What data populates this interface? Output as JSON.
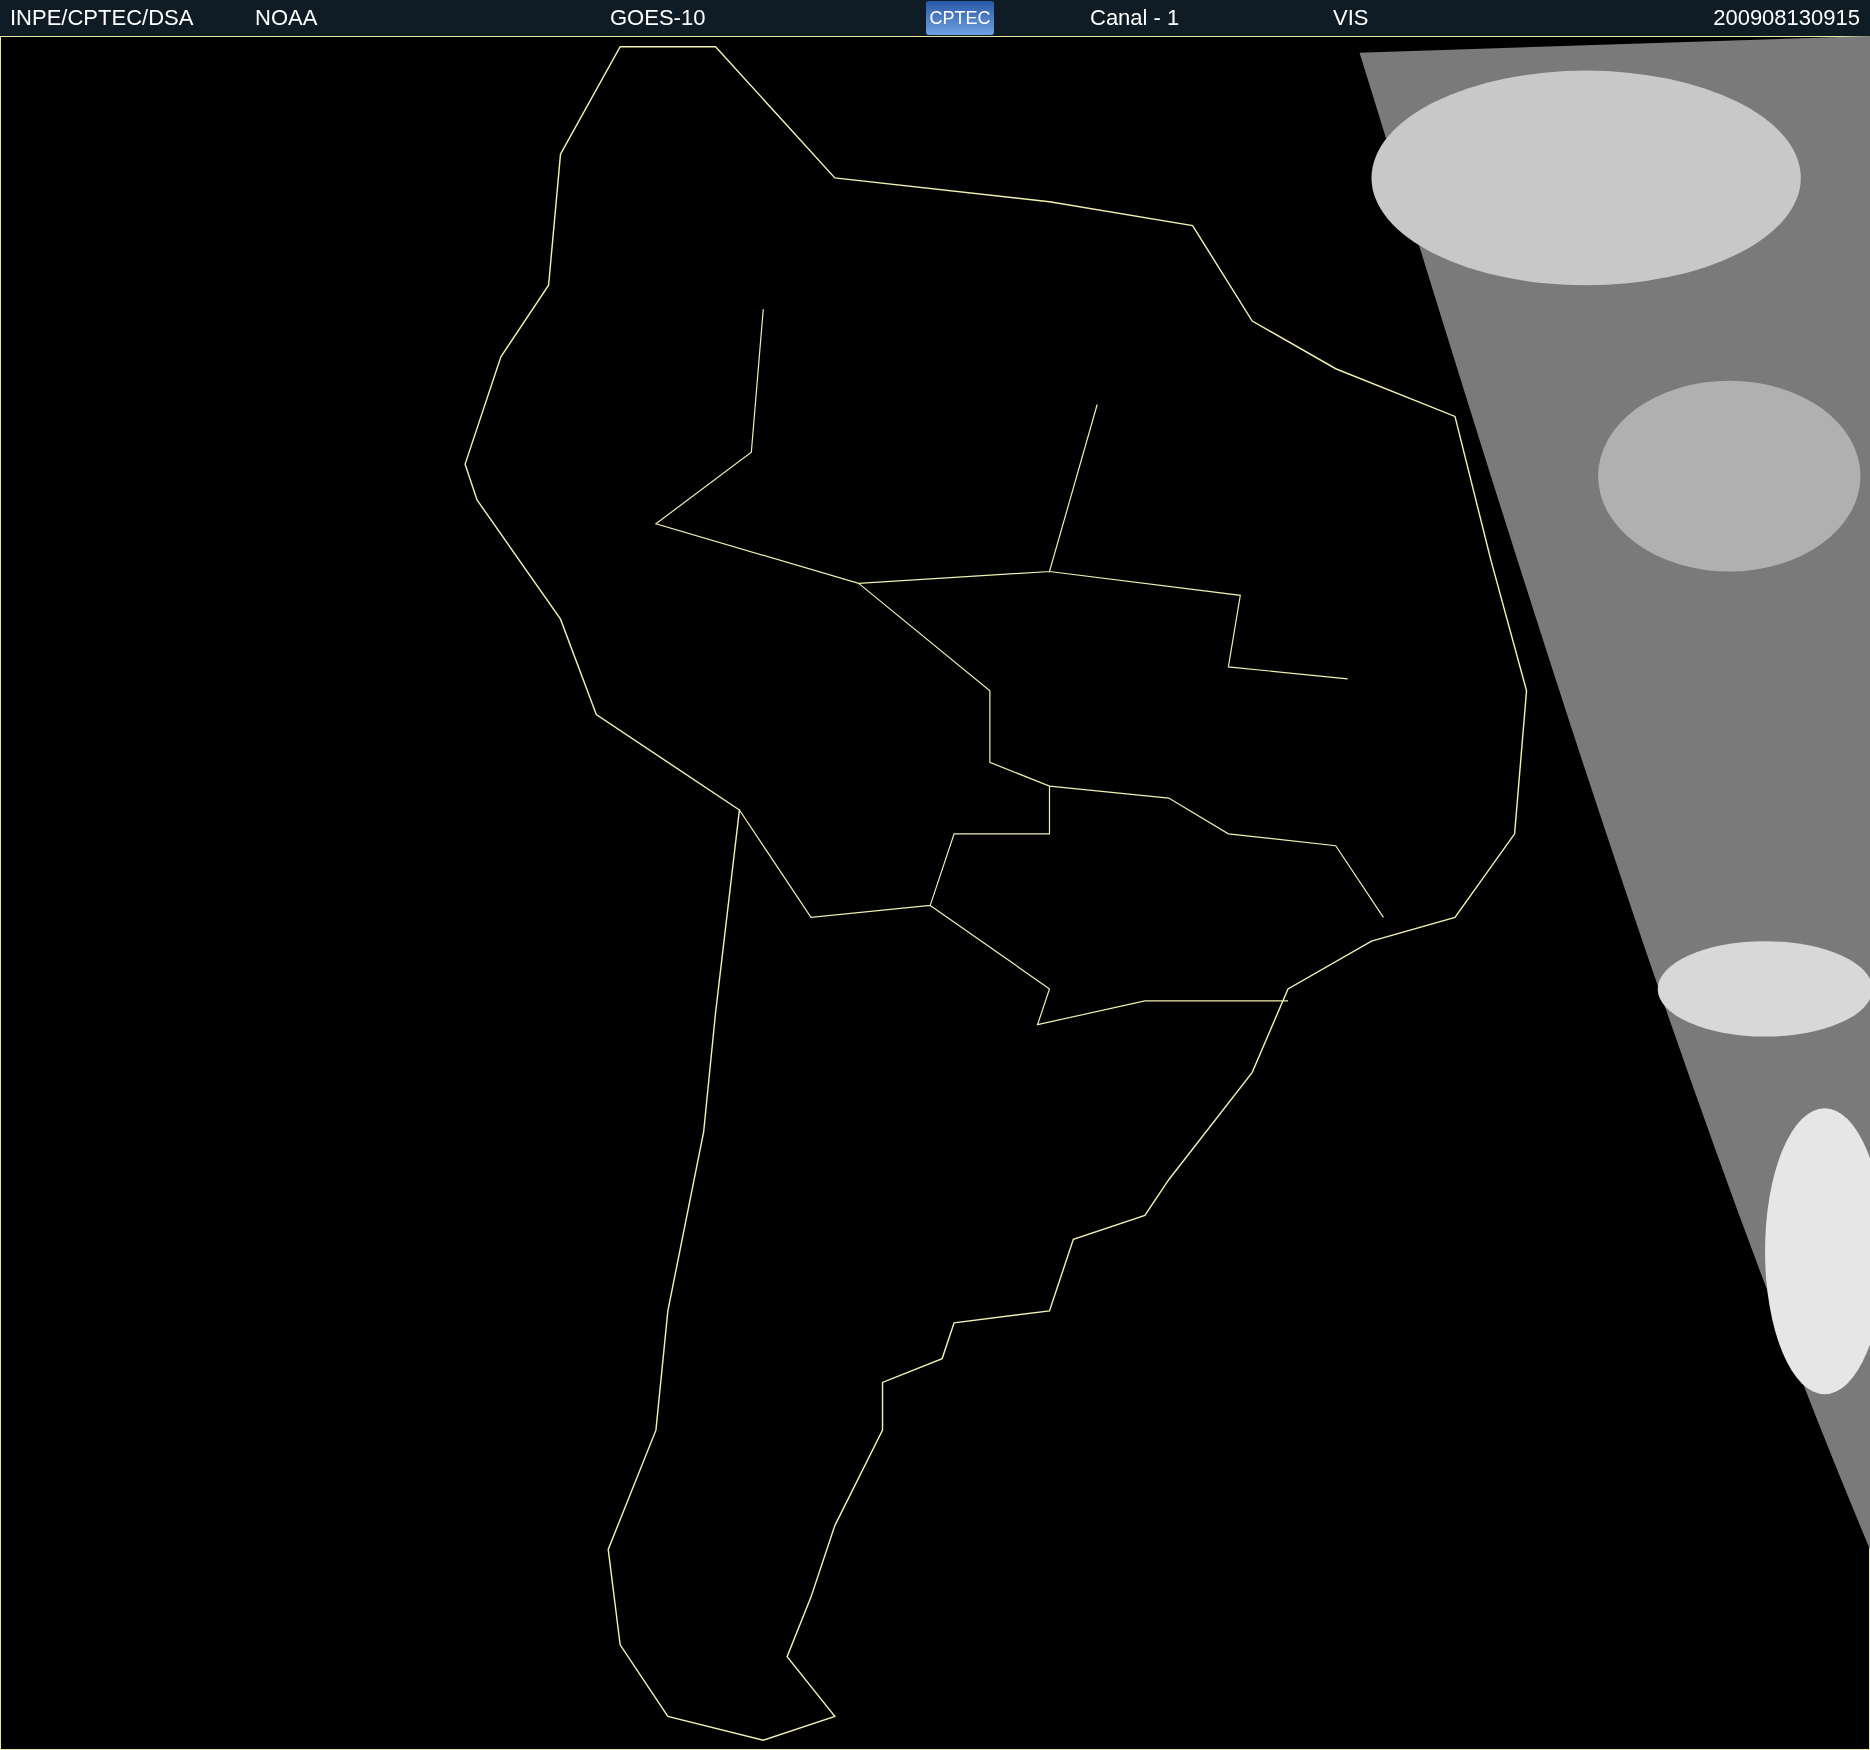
{
  "header": {
    "items": [
      {
        "kind": "text",
        "label": "INPE/CPTEC/DSA"
      },
      {
        "kind": "text",
        "label": "NOAA"
      },
      {
        "kind": "text",
        "label": "GOES-10"
      },
      {
        "kind": "logo",
        "label": "CPTEC"
      },
      {
        "kind": "text",
        "label": "Canal - 1"
      },
      {
        "kind": "text",
        "label": "VIS"
      },
      {
        "kind": "text",
        "label": "200908130915"
      }
    ]
  }
}
